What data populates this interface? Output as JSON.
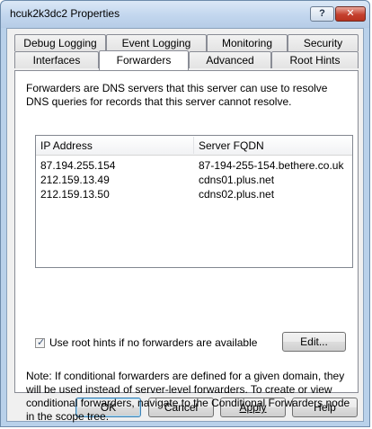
{
  "window": {
    "title": "hcuk2k3dc2 Properties",
    "help_glyph": "?",
    "close_glyph": "✕"
  },
  "tabs_row1": [
    {
      "label": "Debug Logging"
    },
    {
      "label": "Event Logging"
    },
    {
      "label": "Monitoring"
    },
    {
      "label": "Security"
    }
  ],
  "tabs_row2": [
    {
      "label": "Interfaces"
    },
    {
      "label": "Forwarders",
      "active": true
    },
    {
      "label": "Advanced"
    },
    {
      "label": "Root Hints"
    }
  ],
  "panel": {
    "description": "Forwarders are DNS servers that this server can use to resolve DNS queries for records that this server cannot resolve.",
    "columns": [
      "IP Address",
      "Server FQDN"
    ],
    "rows": [
      {
        "ip": "87.194.255.154",
        "fqdn": "87-194-255-154.bethere.co.uk"
      },
      {
        "ip": "212.159.13.49",
        "fqdn": "cdns01.plus.net"
      },
      {
        "ip": "212.159.13.50",
        "fqdn": "cdns02.plus.net"
      }
    ],
    "use_root_hints_label": "Use root hints if no forwarders are available",
    "use_root_hints_checked": true,
    "edit_label": "Edit...",
    "note": "Note: If conditional forwarders are defined for a given domain, they will be used instead of server-level forwarders.  To create or view conditional forwarders, navigate to the Conditional Forwarders node in the scope tree."
  },
  "buttons": {
    "ok": "OK",
    "cancel": "Cancel",
    "apply": "Apply",
    "help": "Help"
  },
  "colors": {
    "titlebar": "#c2d6ee",
    "close_button": "#c5412f",
    "dialog_bg": "#f0f0f0"
  }
}
